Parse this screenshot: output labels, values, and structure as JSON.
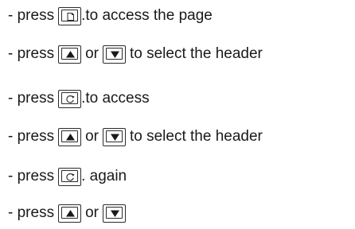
{
  "steps": [
    {
      "prefix": "- press",
      "key": "page-icon",
      "suffix": ".to access the page"
    },
    {
      "prefix": "- press",
      "key": "up-arrow-icon",
      "middle": "or",
      "key2": "down-arrow-icon",
      "suffix": "to select the header"
    },
    {
      "prefix": "- press",
      "key": "scroll-icon",
      "suffix": ".to access"
    },
    {
      "prefix": "- press",
      "key": "up-arrow-icon",
      "middle": "or",
      "key2": "down-arrow-icon",
      "suffix": "to select the header"
    },
    {
      "prefix": "- press",
      "key": "scroll-icon",
      "suffix": ". again"
    },
    {
      "prefix": "- press",
      "key": "up-arrow-icon",
      "middle": "or",
      "key2": "down-arrow-icon"
    }
  ]
}
